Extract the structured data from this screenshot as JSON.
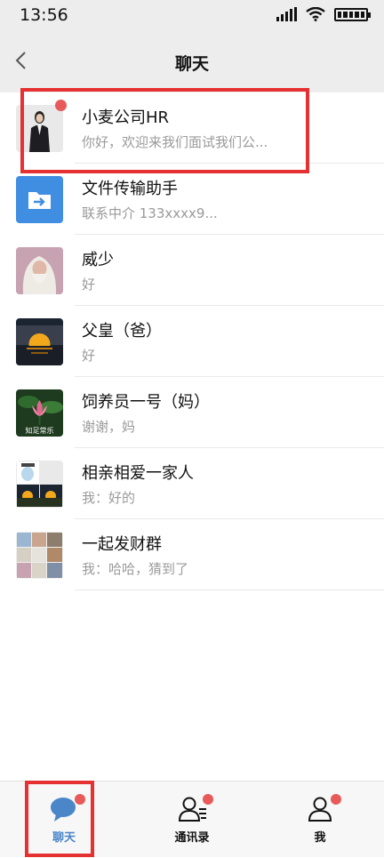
{
  "status_bar": {
    "time": "13:56"
  },
  "header": {
    "title": "聊天"
  },
  "chats": [
    {
      "name": "小麦公司HR",
      "preview": "你好，欢迎来我们面试我们公...",
      "avatar": "woman-in-suit-avatar",
      "unread": true
    },
    {
      "name": "文件传输助手",
      "preview": "联系中介 133xxxx9...",
      "avatar": "file-transfer-icon",
      "unread": false
    },
    {
      "name": "威少",
      "preview": "好",
      "avatar": "wizard-avatar",
      "unread": false
    },
    {
      "name": "父皇（爸）",
      "preview": "好",
      "avatar": "sunset-avatar",
      "unread": false
    },
    {
      "name": "饲养员一号（妈）",
      "preview": "谢谢，妈",
      "avatar": "lotus-avatar",
      "avatar_caption": "知足常乐",
      "unread": false
    },
    {
      "name": "相亲相爱一家人",
      "preview": "我：好的",
      "avatar": "group-avatar",
      "unread": false
    },
    {
      "name": "一起发财群",
      "preview": "我：哈哈，猜到了",
      "avatar": "group-grid-avatar",
      "unread": false
    }
  ],
  "tabs": [
    {
      "label": "聊天",
      "icon": "chat-bubble-icon",
      "active": true,
      "dot": true
    },
    {
      "label": "通讯录",
      "icon": "contacts-icon",
      "active": false,
      "dot": true
    },
    {
      "label": "我",
      "icon": "profile-icon",
      "active": false,
      "dot": true
    }
  ],
  "colors": {
    "accent": "#4a86c8",
    "highlight": "#e53131",
    "unread_dot": "#e85a5a",
    "header_bg": "#ededed"
  }
}
